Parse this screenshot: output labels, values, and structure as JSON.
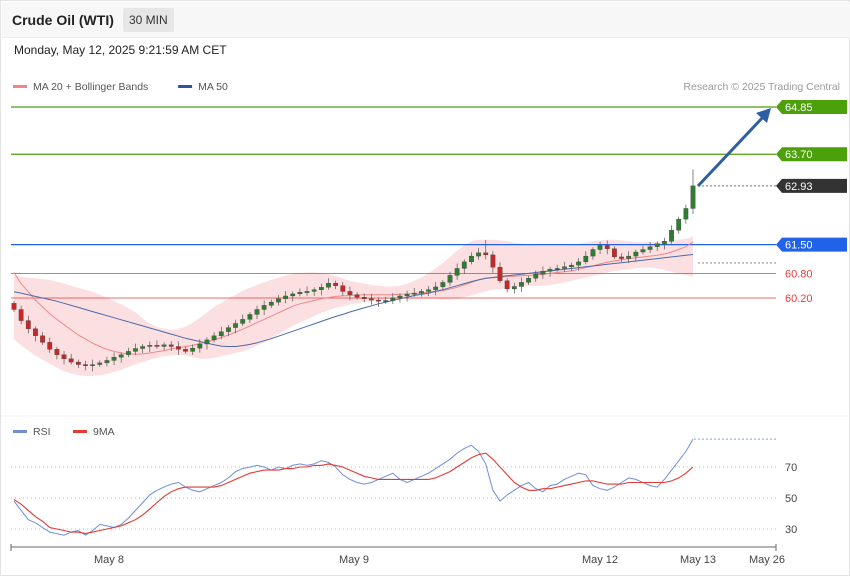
{
  "header": {
    "title": "Crude Oil (WTI)",
    "timeframe": "30 MIN"
  },
  "date_line": "Monday, May 12, 2025 9:21:59 AM CET",
  "copyright": "Research © 2025 Trading Central",
  "colors": {
    "green": "#4ca10b",
    "blue": "#2062e8",
    "red": "#e83b3b",
    "dark": "#333333",
    "candle_up": "#2e7d32",
    "candle_down": "#c62828",
    "ma20": "#f0878a",
    "ma50": "#4a6aa8",
    "bb_fill": "#fcd9dc",
    "rsi": "#6f8fd9",
    "rsi_ma": "#e53935",
    "arrow": "#2f5fa3"
  },
  "chart_data": [
    {
      "type": "candlestick",
      "title": "Crude Oil (WTI)",
      "legend": [
        {
          "name": "MA 20 + Bollinger Bands",
          "color": "#f0878a"
        },
        {
          "name": "MA 50",
          "color": "#2f5597"
        }
      ],
      "legend_position": "top-left",
      "ylim": [
        58.1,
        65.2
      ],
      "x_ticks": [
        "May 8",
        "May 9",
        "May 12",
        "May 13",
        "May 26"
      ],
      "price_levels": [
        {
          "value": 64.85,
          "label": "64.85",
          "color": "#4ca10b",
          "kind": "resistance"
        },
        {
          "value": 63.7,
          "label": "63.70",
          "color": "#4ca10b",
          "kind": "resistance"
        },
        {
          "value": 62.93,
          "label": "62.93",
          "color": "#333333",
          "kind": "last"
        },
        {
          "value": 61.5,
          "label": "61.50",
          "color": "#2062e8",
          "kind": "pivot"
        },
        {
          "value": 60.8,
          "label": "60.80",
          "color": "#e83b3b",
          "kind": "support"
        },
        {
          "value": 60.2,
          "label": "60.20",
          "color": "#e83b3b",
          "kind": "support"
        }
      ],
      "closes": [
        59.92,
        59.65,
        59.45,
        59.28,
        59.12,
        58.95,
        58.82,
        58.72,
        58.64,
        58.58,
        58.55,
        58.58,
        58.62,
        58.68,
        58.76,
        58.82,
        58.9,
        58.97,
        59.02,
        59.05,
        59.02,
        59.06,
        59.02,
        58.95,
        58.9,
        58.98,
        59.08,
        59.18,
        59.28,
        59.38,
        59.48,
        59.58,
        59.68,
        59.8,
        59.92,
        60.02,
        60.1,
        60.18,
        60.25,
        60.3,
        60.34,
        60.36,
        60.4,
        60.46,
        60.56,
        60.5,
        60.36,
        60.28,
        60.22,
        60.18,
        60.15,
        60.12,
        60.14,
        60.2,
        60.25,
        60.29,
        60.32,
        60.36,
        60.4,
        60.47,
        60.58,
        60.75,
        60.92,
        61.08,
        61.22,
        61.3,
        61.25,
        60.95,
        60.62,
        60.42,
        60.48,
        60.58,
        60.68,
        60.78,
        60.85,
        60.9,
        60.92,
        60.96,
        61.0,
        61.08,
        61.22,
        61.38,
        61.48,
        61.4,
        61.2,
        61.16,
        61.22,
        61.32,
        61.38,
        61.45,
        61.52,
        61.58,
        61.85,
        62.12,
        62.38,
        62.93
      ],
      "ma20": [
        60.82,
        60.55,
        60.35,
        60.15,
        59.98,
        59.82,
        59.68,
        59.55,
        59.42,
        59.3,
        59.2,
        59.1,
        59.02,
        58.95,
        58.9,
        58.86,
        58.84,
        58.83,
        58.84,
        58.86,
        58.89,
        58.92,
        58.96,
        58.99,
        59.02,
        59.05,
        59.09,
        59.13,
        59.18,
        59.24,
        59.3,
        59.37,
        59.44,
        59.52,
        59.6,
        59.68,
        59.76,
        59.84,
        59.92,
        60.0,
        60.06,
        60.1,
        60.14,
        60.18,
        60.21,
        60.24,
        60.25,
        60.26,
        60.27,
        60.28,
        60.28,
        60.28,
        60.28,
        60.28,
        60.29,
        60.3,
        60.31,
        60.32,
        60.34,
        60.36,
        60.38,
        60.42,
        60.46,
        60.52,
        60.58,
        60.64,
        60.68,
        60.7,
        60.71,
        60.72,
        60.73,
        60.74,
        60.75,
        60.76,
        60.78,
        60.8,
        60.82,
        60.84,
        60.86,
        60.9,
        60.94,
        60.98,
        61.03,
        61.07,
        61.1,
        61.13,
        61.16,
        61.18,
        61.2,
        61.22,
        61.24,
        61.27,
        61.32,
        61.38,
        61.45,
        61.56
      ],
      "ma50": [
        60.35,
        60.32,
        60.28,
        60.24,
        60.2,
        60.16,
        60.12,
        60.07,
        60.02,
        59.97,
        59.92,
        59.87,
        59.82,
        59.77,
        59.72,
        59.67,
        59.62,
        59.57,
        59.52,
        59.47,
        59.42,
        59.37,
        59.32,
        59.27,
        59.22,
        59.18,
        59.14,
        59.1,
        59.06,
        59.03,
        59.02,
        59.02,
        59.04,
        59.07,
        59.11,
        59.16,
        59.21,
        59.27,
        59.33,
        59.39,
        59.45,
        59.51,
        59.57,
        59.63,
        59.69,
        59.75,
        59.8,
        59.86,
        59.91,
        59.96,
        60.01,
        60.06,
        60.1,
        60.14,
        60.18,
        60.22,
        60.26,
        60.29,
        60.32,
        60.36,
        60.4,
        60.45,
        60.5,
        60.55,
        60.6,
        60.64,
        60.68,
        60.7,
        60.72,
        60.74,
        60.76,
        60.78,
        60.8,
        60.82,
        60.84,
        60.86,
        60.88,
        60.9,
        60.92,
        60.94,
        60.96,
        60.98,
        61.0,
        61.02,
        61.04,
        61.06,
        61.08,
        61.1,
        61.12,
        61.14,
        61.16,
        61.18,
        61.2,
        61.22,
        61.24,
        61.26
      ],
      "bb_upper": [
        60.75,
        60.72,
        60.7,
        60.68,
        60.66,
        60.64,
        60.6,
        60.55,
        60.5,
        60.45,
        60.4,
        60.35,
        60.28,
        60.2,
        60.12,
        60.05,
        59.95,
        59.85,
        59.7,
        59.58,
        59.5,
        59.45,
        59.42,
        59.45,
        59.5,
        59.6,
        59.72,
        59.85,
        59.98,
        60.08,
        60.18,
        60.28,
        60.38,
        60.45,
        60.52,
        60.58,
        60.64,
        60.7,
        60.75,
        60.78,
        60.8,
        60.82,
        60.82,
        60.8,
        60.78,
        60.74,
        60.68,
        60.62,
        60.58,
        60.55,
        60.52,
        60.5,
        60.48,
        60.48,
        60.5,
        60.55,
        60.62,
        60.7,
        60.8,
        60.92,
        61.05,
        61.2,
        61.35,
        61.48,
        61.58,
        61.62,
        61.62,
        61.62,
        61.6,
        61.58,
        61.55,
        61.52,
        61.5,
        61.48,
        61.48,
        61.48,
        61.48,
        61.48,
        61.5,
        61.52,
        61.55,
        61.58,
        61.6,
        61.62,
        61.62,
        61.6,
        61.58,
        61.57,
        61.56,
        61.56,
        61.56,
        61.58,
        61.6,
        61.62,
        61.64,
        61.7
      ],
      "bb_lower": [
        59.2,
        59.05,
        58.92,
        58.8,
        58.7,
        58.6,
        58.5,
        58.42,
        58.36,
        58.32,
        58.3,
        58.3,
        58.32,
        58.35,
        58.4,
        58.45,
        58.52,
        58.58,
        58.64,
        58.7,
        58.74,
        58.78,
        58.8,
        58.82,
        58.8,
        58.76,
        58.72,
        58.72,
        58.74,
        58.78,
        58.82,
        58.86,
        58.9,
        58.96,
        59.04,
        59.12,
        59.22,
        59.32,
        59.42,
        59.52,
        59.6,
        59.68,
        59.76,
        59.84,
        59.9,
        59.96,
        60.0,
        60.04,
        60.08,
        60.1,
        60.12,
        60.14,
        60.16,
        60.18,
        60.18,
        60.18,
        60.18,
        60.18,
        60.18,
        60.18,
        60.16,
        60.16,
        60.18,
        60.22,
        60.26,
        60.32,
        60.36,
        60.4,
        60.42,
        60.44,
        60.46,
        60.48,
        60.5,
        60.5,
        60.5,
        60.52,
        60.54,
        60.58,
        60.62,
        60.66,
        60.7,
        60.74,
        60.78,
        60.82,
        60.86,
        60.88,
        60.9,
        60.92,
        60.94,
        60.94,
        60.92,
        60.88,
        60.84,
        60.8,
        60.76,
        60.72
      ]
    },
    {
      "type": "line",
      "title": "RSI",
      "legend": [
        {
          "name": "RSI",
          "color": "#6f8fd9"
        },
        {
          "name": "9MA",
          "color": "#e53935"
        }
      ],
      "ylim": [
        18,
        87
      ],
      "y_ticks": [
        70,
        50,
        30
      ],
      "rsi": [
        48,
        42,
        36,
        34,
        31,
        28,
        27,
        26,
        28,
        29,
        26,
        29,
        33,
        32,
        31,
        33,
        37,
        42,
        47,
        52,
        55,
        57,
        59,
        60,
        57,
        55,
        54,
        56,
        58,
        60,
        63,
        67,
        69,
        70,
        71,
        70,
        68,
        70,
        69,
        71,
        72,
        71,
        72,
        74,
        73,
        70,
        65,
        62,
        60,
        59,
        60,
        62,
        64,
        66,
        62,
        60,
        62,
        64,
        66,
        69,
        72,
        75,
        79,
        82,
        84,
        80,
        72,
        55,
        48,
        52,
        55,
        58,
        60,
        56,
        54,
        58,
        59,
        62,
        64,
        66,
        65,
        58,
        56,
        55,
        57,
        60,
        63,
        62,
        60,
        58,
        57,
        62,
        68,
        74,
        80,
        88
      ],
      "rsi_ma": [
        49,
        46,
        42,
        38,
        35,
        31,
        30,
        29,
        28,
        28,
        27,
        28,
        29,
        30,
        31,
        32,
        34,
        36,
        39,
        43,
        47,
        51,
        54,
        56,
        57,
        57,
        57,
        57,
        57,
        58,
        60,
        62,
        64,
        66,
        67,
        68,
        68,
        68,
        69,
        69,
        70,
        70,
        71,
        71,
        72,
        71,
        70,
        68,
        66,
        64,
        63,
        62,
        62,
        62,
        62,
        62,
        62,
        62,
        62,
        63,
        65,
        67,
        70,
        73,
        76,
        78,
        79,
        75,
        70,
        65,
        60,
        57,
        55,
        55,
        56,
        56,
        57,
        58,
        59,
        60,
        61,
        61,
        60,
        59,
        59,
        59,
        60,
        60,
        60,
        60,
        60,
        60,
        61,
        63,
        66,
        70
      ]
    }
  ]
}
